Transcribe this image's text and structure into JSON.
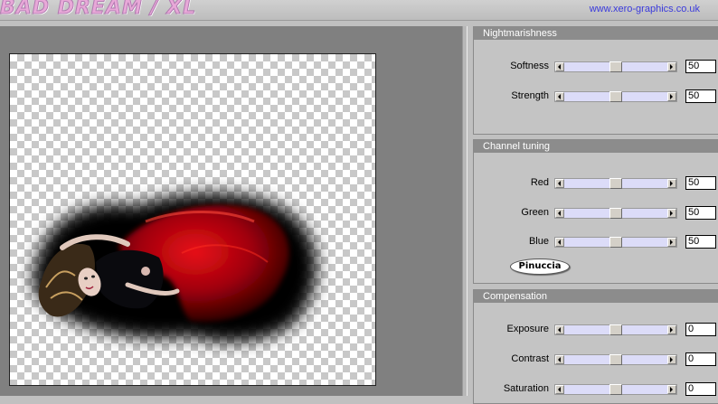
{
  "app": {
    "title": "BAD DREAM / XL",
    "url": "www.xero-graphics.co.uk"
  },
  "groups": [
    {
      "title": "Nightmarishness",
      "controls": [
        {
          "label": "Softness",
          "value": "50",
          "level": 0.5
        },
        {
          "label": "Strength",
          "value": "50",
          "level": 0.5
        }
      ]
    },
    {
      "title": "Channel tuning",
      "controls": [
        {
          "label": "Red",
          "value": "50",
          "level": 0.5
        },
        {
          "label": "Green",
          "value": "50",
          "level": 0.5
        },
        {
          "label": "Blue",
          "value": "50",
          "level": 0.5
        }
      ],
      "badge": "Pinuccia"
    },
    {
      "title": "Compensation",
      "controls": [
        {
          "label": "Exposure",
          "value": "0",
          "level": 0.5
        },
        {
          "label": "Contrast",
          "value": "0",
          "level": 0.5
        },
        {
          "label": "Saturation",
          "value": "0",
          "level": 0.5
        }
      ]
    }
  ],
  "colors": {
    "slider_track": "#dcdcf8",
    "group_header": "#8c8c8c",
    "preview_bg": "#808080"
  }
}
